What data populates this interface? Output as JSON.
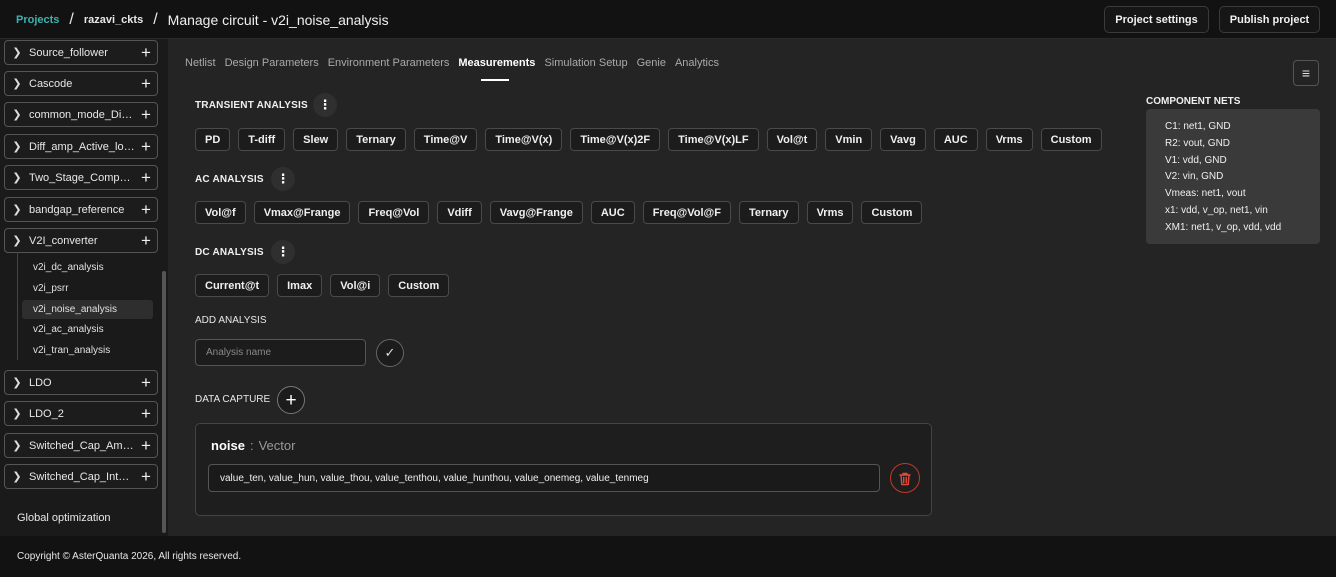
{
  "header": {
    "projects_link": "Projects",
    "separator": "/",
    "project_name": "razavi_ckts",
    "page_title": "Manage circuit - v2i_noise_analysis",
    "settings_button": "Project settings",
    "publish_button": "Publish project"
  },
  "sidebar": {
    "items": [
      {
        "label": "Source_follower"
      },
      {
        "label": "Cascode"
      },
      {
        "label": "common_mode_Diffa..."
      },
      {
        "label": "Diff_amp_Active_load"
      },
      {
        "label": "Two_Stage_Compara..."
      },
      {
        "label": "bandgap_reference"
      },
      {
        "label": "V2I_converter"
      },
      {
        "label": "LDO"
      },
      {
        "label": "LDO_2"
      },
      {
        "label": "Switched_Cap_Ampli..."
      },
      {
        "label": "Switched_Cap_Integr..."
      }
    ],
    "sub_items": [
      {
        "label": "v2i_dc_analysis"
      },
      {
        "label": "v2i_psrr"
      },
      {
        "label": "v2i_noise_analysis"
      },
      {
        "label": "v2i_ac_analysis"
      },
      {
        "label": "v2i_tran_analysis"
      }
    ],
    "global_optimization": "Global optimization"
  },
  "tabs": [
    "Netlist",
    "Design Parameters",
    "Environment Parameters",
    "Measurements",
    "Simulation Setup",
    "Genie",
    "Analytics"
  ],
  "active_tab": "Measurements",
  "transient": {
    "title": "TRANSIENT ANALYSIS",
    "chips": [
      "PD",
      "T-diff",
      "Slew",
      "Ternary",
      "Time@V",
      "Time@V(x)",
      "Time@V(x)2F",
      "Time@V(x)LF",
      "Vol@t",
      "Vmin",
      "Vavg",
      "AUC",
      "Vrms",
      "Custom"
    ]
  },
  "ac": {
    "title": "AC ANALYSIS",
    "chips": [
      "Vol@f",
      "Vmax@Frange",
      "Freq@Vol",
      "Vdiff",
      "Vavg@Frange",
      "AUC",
      "Freq@Vol@F",
      "Ternary",
      "Vrms",
      "Custom"
    ]
  },
  "dc": {
    "title": "DC ANALYSIS",
    "chips": [
      "Current@t",
      "Imax",
      "Vol@i",
      "Custom"
    ]
  },
  "add_analysis": {
    "label": "ADD ANALYSIS",
    "placeholder": "Analysis name"
  },
  "data_capture": {
    "label": "DATA CAPTURE",
    "name": "noise",
    "separator": ":",
    "type": "Vector",
    "value": "value_ten, value_hun, value_thou, value_tenthou, value_hunthou, value_onemeg, value_tenmeg"
  },
  "component_nets": {
    "title": "COMPONENT NETS",
    "lines": [
      "C1: net1, GND",
      "R2: vout, GND",
      "V1: vdd, GND",
      "V2: vin, GND",
      "Vmeas: net1, vout",
      "x1: vdd, v_op, net1, vin",
      "XM1: net1, v_op, vdd, vdd"
    ]
  },
  "footer": {
    "copyright": "Copyright © AsterQuanta 2026, All rights reserved."
  },
  "colors": {
    "accent": "#3bb3b0",
    "danger": "#e04a3a"
  }
}
